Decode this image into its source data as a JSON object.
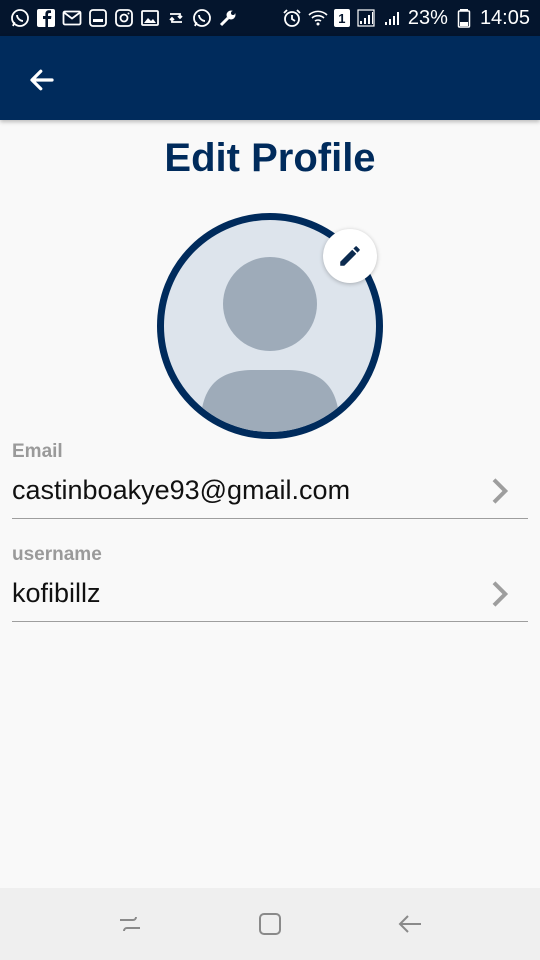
{
  "status_bar": {
    "battery_percent": "23%",
    "time": "14:05",
    "sim_number": "1",
    "left_icons": [
      "whatsapp-icon",
      "facebook-icon",
      "gmail-icon",
      "message-icon",
      "instagram-icon",
      "gallery-icon",
      "retweet-icon",
      "whatsapp-icon",
      "wrench-icon"
    ],
    "right_icons": [
      "alarm-icon",
      "wifi-icon",
      "sim-icon",
      "signal-icon",
      "signal-icon",
      "battery-icon"
    ]
  },
  "app_bar": {
    "back_icon": "arrow-left-icon"
  },
  "page": {
    "title": "Edit Profile"
  },
  "avatar": {
    "edit_icon": "pencil-icon"
  },
  "fields": {
    "email": {
      "label": "Email",
      "value": "castinboakye93@gmail.com"
    },
    "username": {
      "label": "username",
      "value": "kofibillz"
    }
  },
  "nav_bar": {
    "icons": [
      "recent-apps-icon",
      "home-icon",
      "back-icon"
    ]
  },
  "colors": {
    "primary": "#002b5c",
    "status_bar": "#04152d",
    "avatar_bg": "#dde4ec",
    "avatar_figure": "#9eabb9"
  }
}
